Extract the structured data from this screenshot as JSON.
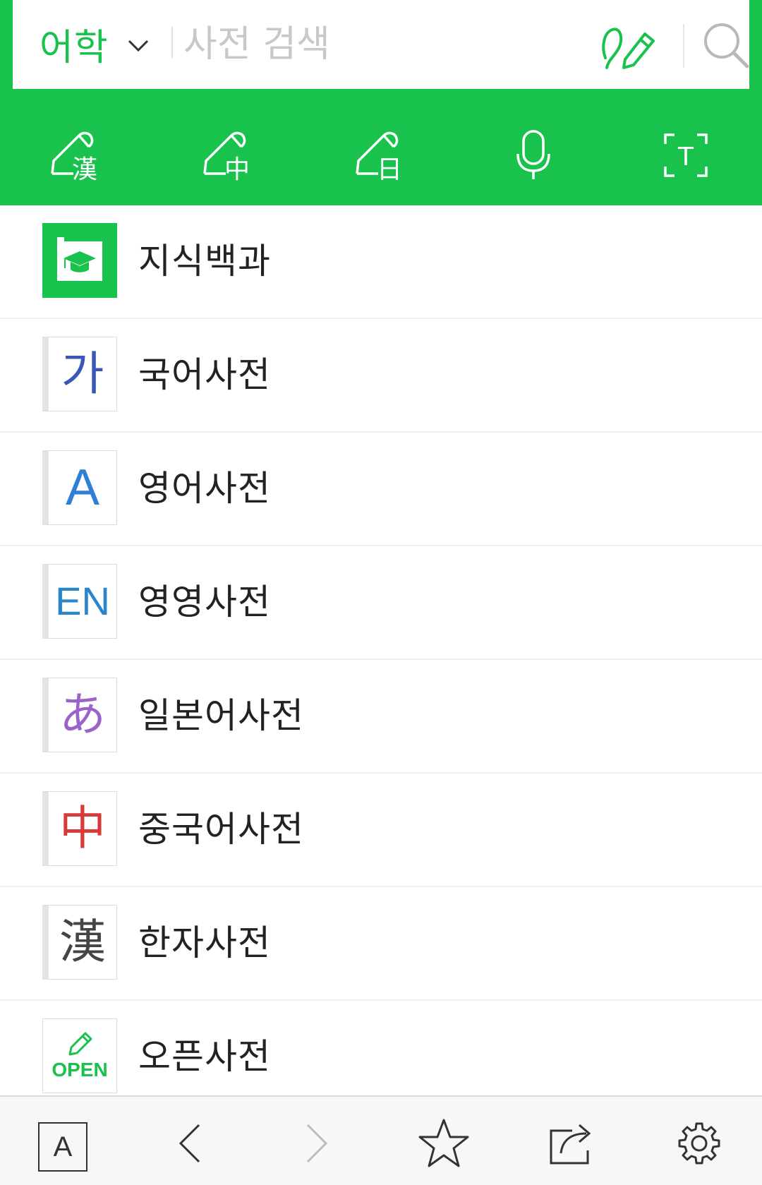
{
  "search": {
    "category": "어학",
    "placeholder": "사전 검색"
  },
  "toolbar": {
    "tools": [
      {
        "icon": "hanja-handwriting-icon",
        "glyph": "漢"
      },
      {
        "icon": "chinese-handwriting-icon",
        "glyph": "中"
      },
      {
        "icon": "japanese-handwriting-icon",
        "glyph": "日"
      },
      {
        "icon": "microphone-icon"
      },
      {
        "icon": "text-scan-icon",
        "glyph": "T"
      }
    ]
  },
  "dictionaries": [
    {
      "label": "지식백과",
      "icon": "encyclopedia-icon"
    },
    {
      "label": "국어사전",
      "glyph": "가",
      "color": "#3a57b8"
    },
    {
      "label": "영어사전",
      "glyph": "A",
      "color": "#2f7fd6"
    },
    {
      "label": "영영사전",
      "glyph": "EN",
      "color": "#2a86c9"
    },
    {
      "label": "일본어사전",
      "glyph": "あ",
      "color": "#9b63c9"
    },
    {
      "label": "중국어사전",
      "glyph": "中",
      "color": "#d63a3a"
    },
    {
      "label": "한자사전",
      "glyph": "漢",
      "color": "#444444"
    },
    {
      "label": "오픈사전",
      "glyph": "OPEN",
      "color": "#19c24c"
    }
  ],
  "bottom_bar": {
    "font_label": "A"
  },
  "colors": {
    "brand": "#19c24c"
  }
}
